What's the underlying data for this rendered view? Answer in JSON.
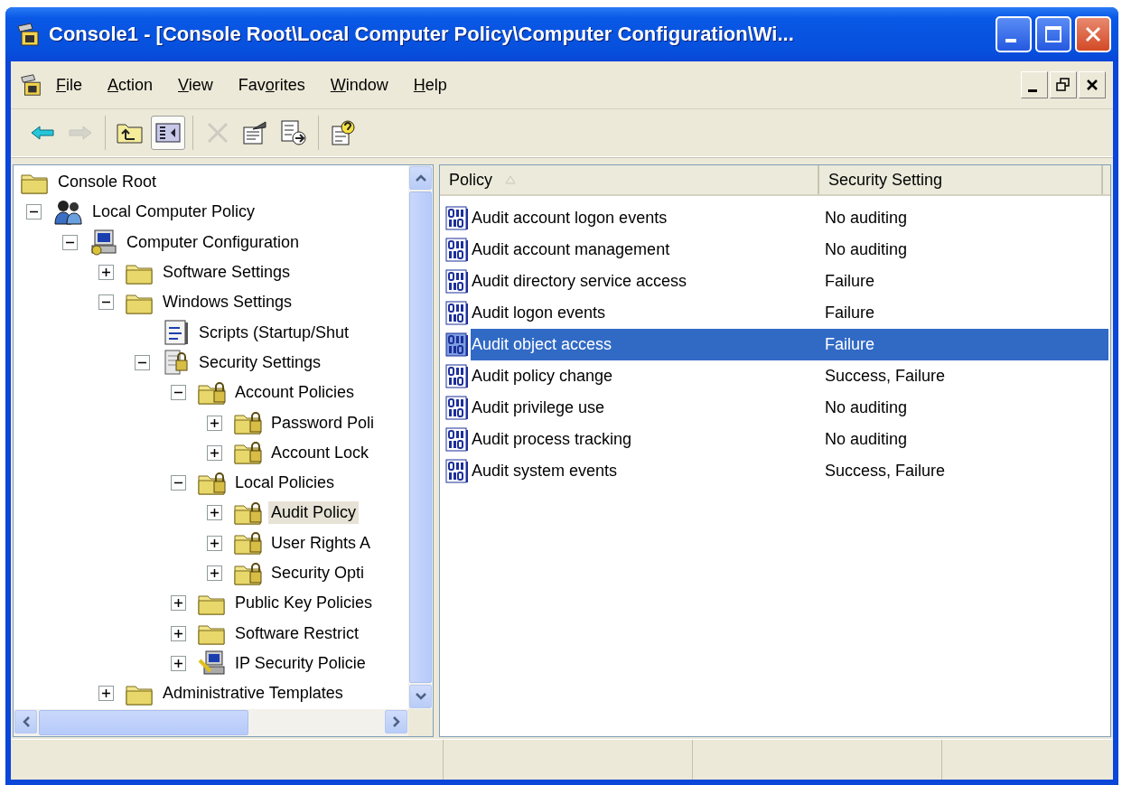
{
  "window": {
    "title": "Console1 - [Console Root\\Local Computer Policy\\Computer Configuration\\Wi..."
  },
  "menu": [
    {
      "parts": [
        {
          "text": "F",
          "underlined": true
        },
        {
          "text": "ile",
          "underlined": false
        }
      ]
    },
    {
      "parts": [
        {
          "text": "A",
          "underlined": true
        },
        {
          "text": "ction",
          "underlined": false
        }
      ]
    },
    {
      "parts": [
        {
          "text": "V",
          "underlined": true
        },
        {
          "text": "iew",
          "underlined": false
        }
      ]
    },
    {
      "parts": [
        {
          "text": "Fav",
          "underlined": false
        },
        {
          "text": "o",
          "underlined": true
        },
        {
          "text": "rites",
          "underlined": false
        }
      ]
    },
    {
      "parts": [
        {
          "text": "W",
          "underlined": true
        },
        {
          "text": "indow",
          "underlined": false
        }
      ]
    },
    {
      "parts": [
        {
          "text": "H",
          "underlined": true
        },
        {
          "text": "elp",
          "underlined": false
        }
      ]
    }
  ],
  "toolbar": [
    {
      "buttons": [
        {
          "kind": "back",
          "disabled": false,
          "pressed": false
        },
        {
          "kind": "forward",
          "disabled": true,
          "pressed": false
        }
      ]
    },
    {
      "buttons": [
        {
          "kind": "up",
          "disabled": false,
          "pressed": false
        },
        {
          "kind": "tree",
          "disabled": false,
          "pressed": true
        }
      ]
    },
    {
      "buttons": [
        {
          "kind": "delete",
          "disabled": true,
          "pressed": false
        },
        {
          "kind": "properties",
          "disabled": false,
          "pressed": false
        },
        {
          "kind": "export",
          "disabled": false,
          "pressed": false
        }
      ]
    },
    {
      "buttons": [
        {
          "kind": "help",
          "disabled": false,
          "pressed": false
        }
      ]
    }
  ],
  "tree": [
    {
      "label": "Console Root",
      "kind": "folder",
      "has_toggle": false,
      "selected": false,
      "children": [
        {
          "label": "Local Computer Policy",
          "kind": "users",
          "has_toggle": true,
          "expanded": true,
          "selected": false,
          "children": [
            {
              "label": "Computer Configuration",
              "kind": "computer",
              "has_toggle": true,
              "expanded": true,
              "selected": false,
              "children": [
                {
                  "label": "Software Settings",
                  "kind": "folder",
                  "has_toggle": true,
                  "expanded": false,
                  "selected": false
                },
                {
                  "label": "Windows Settings",
                  "kind": "folder",
                  "has_toggle": true,
                  "expanded": true,
                  "selected": false,
                  "children": [
                    {
                      "label": "Scripts (Startup/Shut",
                      "kind": "scripts",
                      "has_toggle": false,
                      "selected": false
                    },
                    {
                      "label": "Security Settings",
                      "kind": "security",
                      "has_toggle": true,
                      "expanded": true,
                      "selected": false,
                      "children": [
                        {
                          "label": "Account Policies",
                          "kind": "lock-folder",
                          "has_toggle": true,
                          "expanded": true,
                          "selected": false,
                          "children": [
                            {
                              "label": "Password Poli",
                              "kind": "lock-folder",
                              "has_toggle": true,
                              "expanded": false,
                              "selected": false
                            },
                            {
                              "label": "Account Lock",
                              "kind": "lock-folder",
                              "has_toggle": true,
                              "expanded": false,
                              "selected": false
                            }
                          ]
                        },
                        {
                          "label": "Local Policies",
                          "kind": "lock-folder",
                          "has_toggle": true,
                          "expanded": true,
                          "selected": false,
                          "children": [
                            {
                              "label": "Audit Policy",
                              "kind": "lock-folder",
                              "has_toggle": true,
                              "expanded": false,
                              "selected": true
                            },
                            {
                              "label": "User Rights A",
                              "kind": "lock-folder",
                              "has_toggle": true,
                              "expanded": false,
                              "selected": false
                            },
                            {
                              "label": "Security Opti",
                              "kind": "lock-folder",
                              "has_toggle": true,
                              "expanded": false,
                              "selected": false
                            }
                          ]
                        },
                        {
                          "label": "Public Key Policies",
                          "kind": "folder",
                          "has_toggle": true,
                          "expanded": false,
                          "selected": false
                        },
                        {
                          "label": "Software Restrict",
                          "kind": "folder",
                          "has_toggle": true,
                          "expanded": false,
                          "selected": false
                        },
                        {
                          "label": "IP Security Policie",
                          "kind": "ip",
                          "has_toggle": true,
                          "expanded": false,
                          "selected": false
                        }
                      ]
                    }
                  ]
                },
                {
                  "label": "Administrative Templates",
                  "kind": "folder",
                  "has_toggle": true,
                  "expanded": false,
                  "selected": false
                }
              ]
            }
          ]
        }
      ]
    }
  ],
  "table": {
    "columns": [
      {
        "label": "Policy",
        "sorted": true
      },
      {
        "label": "Security Setting",
        "sorted": false
      }
    ],
    "rows": [
      {
        "policy": "Audit account logon events",
        "setting": "No auditing",
        "selected": false
      },
      {
        "policy": "Audit account management",
        "setting": "No auditing",
        "selected": false
      },
      {
        "policy": "Audit directory service access",
        "setting": "Failure",
        "selected": false
      },
      {
        "policy": "Audit logon events",
        "setting": "Failure",
        "selected": false
      },
      {
        "policy": "Audit object access",
        "setting": "Failure",
        "selected": true
      },
      {
        "policy": "Audit policy change",
        "setting": "Success, Failure",
        "selected": false
      },
      {
        "policy": "Audit privilege use",
        "setting": "No auditing",
        "selected": false
      },
      {
        "policy": "Audit process tracking",
        "setting": "No auditing",
        "selected": false
      },
      {
        "policy": "Audit system events",
        "setting": "Success, Failure",
        "selected": false
      }
    ]
  }
}
